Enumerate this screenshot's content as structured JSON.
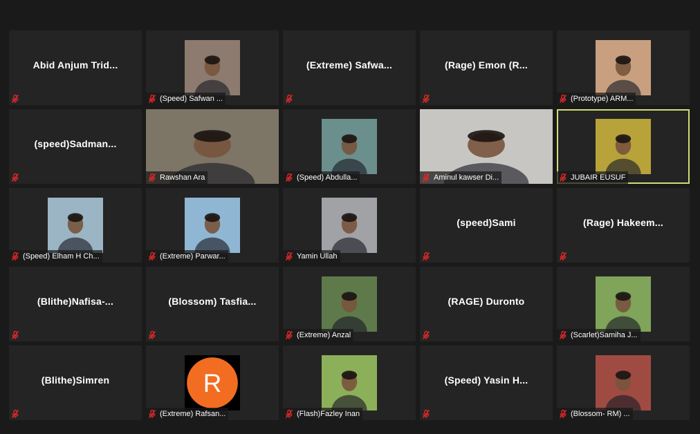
{
  "meeting": {
    "participants": [
      {
        "name": "Abid  Anjum  Trid...",
        "view": "name"
      },
      {
        "name": "(Speed) Safwan ...",
        "view": "video",
        "bg": "#8c7b6e"
      },
      {
        "name": "(Extreme)  Safwa...",
        "view": "name"
      },
      {
        "name": "(Rage)  Emon  (R...",
        "view": "name"
      },
      {
        "name": "(Prototype) ARM...",
        "view": "video",
        "bg": "#c9a07f"
      },
      {
        "name": "(speed)Sadman...",
        "view": "name"
      },
      {
        "name": "Rawshan Ara",
        "view": "video-wide",
        "bg": "#7d7566"
      },
      {
        "name": "(Speed) Abdulla...",
        "view": "video",
        "bg": "#6a8f8c"
      },
      {
        "name": "Aminul kawser Di...",
        "view": "video-wide",
        "bg": "#c8c6c2"
      },
      {
        "name": "JUBAIR EUSUF",
        "view": "video",
        "bg": "#b7a33a",
        "active": true
      },
      {
        "name": "(Speed) Elham H Ch...",
        "view": "video",
        "bg": "#9bb5c4"
      },
      {
        "name": "(Extreme) Parwar...",
        "view": "video",
        "bg": "#8fb7d4"
      },
      {
        "name": "Yamin Ullah",
        "view": "video",
        "bg": "#a0a2a6"
      },
      {
        "name": "(speed)Sami",
        "view": "name"
      },
      {
        "name": "(Rage)  Hakeem...",
        "view": "name"
      },
      {
        "name": "(Blithe)Nafisa-...",
        "view": "name"
      },
      {
        "name": "(Blossom)  Tasfia...",
        "view": "name"
      },
      {
        "name": "(Extreme) Anzal",
        "view": "video",
        "bg": "#5e7a4a"
      },
      {
        "name": "(RAGE)  Duronto",
        "view": "name"
      },
      {
        "name": "(Scarlet)Samiha J...",
        "view": "video",
        "bg": "#7fa45a"
      },
      {
        "name": "(Blithe)Simren",
        "view": "name"
      },
      {
        "name": "(Extreme) Rafsan...",
        "view": "avatar",
        "avatar_letter": "R",
        "bg": "#f26d21"
      },
      {
        "name": "(Flash)Fazley Inan",
        "view": "video",
        "bg": "#8cb05a"
      },
      {
        "name": "(Speed)  Yasin  H...",
        "view": "name"
      },
      {
        "name": "(Blossom- RM) ...",
        "view": "video",
        "bg": "#a04b42"
      }
    ]
  },
  "icons": {
    "mute": "microphone-muted-icon"
  },
  "colors": {
    "tile": "#242424",
    "background": "#1a1a1a",
    "mute_red": "#e02828",
    "active_border": "#d4dc76"
  }
}
